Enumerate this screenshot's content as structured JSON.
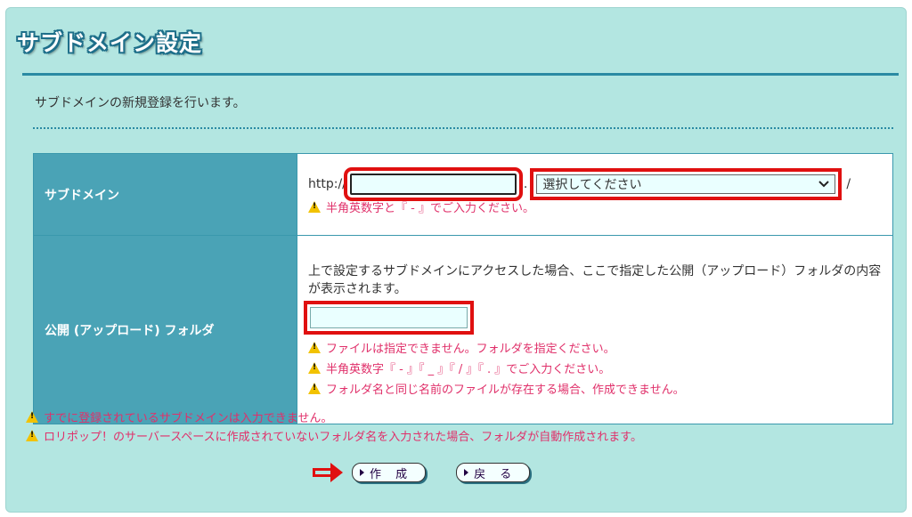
{
  "page": {
    "title": "サブドメイン設定",
    "intro": "サブドメインの新規登録を行います。"
  },
  "form": {
    "subdomain": {
      "label": "サブドメイン",
      "prefix": "http://",
      "input_value": "",
      "dot": ".",
      "select_value": "選択してください",
      "suffix": "/",
      "warning": "半角英数字と『 - 』でご入力ください。"
    },
    "folder": {
      "label": "公開 (アップロード) フォルダ",
      "description": "上で設定するサブドメインにアクセスした場合、ここで指定した公開（アップロード）フォルダの内容が表示されます。",
      "input_value": "",
      "warnings": [
        "ファイルは指定できません。フォルダを指定ください。",
        "半角英数字『 - 』『 _ 』『 / 』『 . 』でご入力ください。",
        "フォルダ名と同じ名前のファイルが存在する場合、作成できません。"
      ]
    }
  },
  "notes": [
    "すでに登録されているサブドメインは入力できません。",
    "ロリポップ！のサーバースペースに作成されていないフォルダ名を入力された場合、フォルダが自動作成されます。"
  ],
  "buttons": {
    "create": "作 成",
    "back": "戻 る"
  },
  "colors": {
    "panel": "#b3e6e1",
    "header_cell": "#4aa3b6",
    "warning_text": "#e0306a",
    "highlight": "#e01010"
  }
}
